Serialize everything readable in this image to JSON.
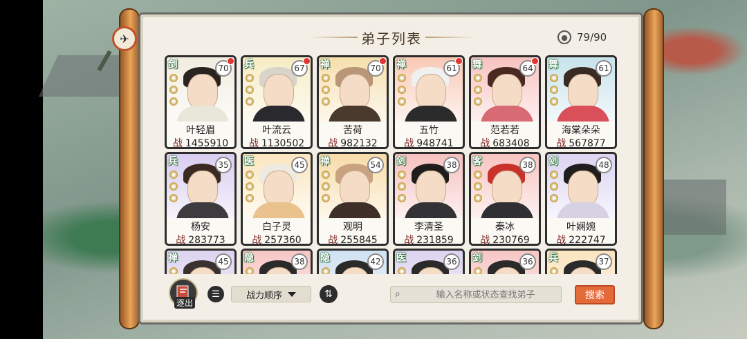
{
  "title": "弟子列表",
  "capacity": "79/90",
  "colors": {
    "accent": "#e56a3a",
    "panel": "#f3efe6",
    "frame": "#2d2d2d"
  },
  "cards": [
    {
      "name": "叶轻眉",
      "power": "1455910",
      "level": "70",
      "sect": "剑",
      "bg": "#f1ede0",
      "hair": "#2a2420",
      "robe": "#e9e6da",
      "badge": true
    },
    {
      "name": "叶流云",
      "power": "1130502",
      "level": "67",
      "sect": "兵",
      "bg": "#f6ecc4",
      "hair": "#d8d4ca",
      "robe": "#2a2a2e",
      "badge": true
    },
    {
      "name": "苦荷",
      "power": "982132",
      "level": "70",
      "sect": "禅",
      "bg": "#f6dfad",
      "hair": "#b89677",
      "robe": "#4a3a2e",
      "badge": true
    },
    {
      "name": "五竹",
      "power": "948741",
      "level": "61",
      "sect": "禅",
      "bg": "#f9c9b5",
      "hair": "#f0f0f0",
      "robe": "#2b2b2b",
      "badge": true
    },
    {
      "name": "范若若",
      "power": "683408",
      "level": "64",
      "sect": "舞",
      "bg": "#f7c2bf",
      "hair": "#4a2a20",
      "robe": "#d86a73",
      "badge": true
    },
    {
      "name": "海棠朵朵",
      "power": "567877",
      "level": "61",
      "sect": "舞",
      "bg": "#c8e3ec",
      "hair": "#3a2a24",
      "robe": "#d94f5a",
      "badge": false
    },
    {
      "name": "杨安",
      "power": "283773",
      "level": "35",
      "sect": "兵",
      "bg": "#d9cdf0",
      "hair": "#3a2a22",
      "robe": "#3d3b3e",
      "badge": false
    },
    {
      "name": "白子灵",
      "power": "257360",
      "level": "45",
      "sect": "医",
      "bg": "#fbe6bf",
      "hair": "#eeeae2",
      "robe": "#e9c28d",
      "badge": false
    },
    {
      "name": "观明",
      "power": "255845",
      "level": "54",
      "sect": "禅",
      "bg": "#f8dca9",
      "hair": "#c9a380",
      "robe": "#3e3028",
      "badge": false
    },
    {
      "name": "李清圣",
      "power": "231859",
      "level": "38",
      "sect": "剑",
      "bg": "#f6c1bf",
      "hair": "#1f1d1c",
      "robe": "#333235",
      "badge": false
    },
    {
      "name": "秦冰",
      "power": "230769",
      "level": "38",
      "sect": "客",
      "bg": "#f7c4c1",
      "hair": "#c8322a",
      "robe": "#2f2f34",
      "badge": false
    },
    {
      "name": "叶娴婉",
      "power": "222747",
      "level": "48",
      "sect": "剑",
      "bg": "#dcd4f1",
      "hair": "#1f1d1e",
      "robe": "#d6d2e3",
      "badge": false
    },
    {
      "name": "",
      "power": "",
      "level": "45",
      "sect": "禅",
      "bg": "#dcd3f0",
      "hair": "#3a3230",
      "robe": "#444",
      "badge": false
    },
    {
      "name": "",
      "power": "",
      "level": "38",
      "sect": "隐",
      "bg": "#f6c6c4",
      "hair": "#2a2a2a",
      "robe": "#444",
      "badge": false
    },
    {
      "name": "",
      "power": "",
      "level": "42",
      "sect": "隐",
      "bg": "#cfe1f2",
      "hair": "#2a2a2a",
      "robe": "#444",
      "badge": false
    },
    {
      "name": "",
      "power": "",
      "level": "36",
      "sect": "医",
      "bg": "#dcd3f0",
      "hair": "#2a2a2a",
      "robe": "#444",
      "badge": false
    },
    {
      "name": "",
      "power": "",
      "level": "36",
      "sect": "剑",
      "bg": "#f6c6c4",
      "hair": "#2a2a2a",
      "robe": "#444",
      "badge": false
    },
    {
      "name": "",
      "power": "",
      "level": "37",
      "sect": "兵",
      "bg": "#fbe3bf",
      "hair": "#2a2a2a",
      "robe": "#444",
      "badge": false
    }
  ],
  "power_prefix": "战",
  "toolbar": {
    "expel_label": "逐出",
    "sort_label": "战力顺序",
    "search_placeholder": "输入名称或状态查找弟子",
    "search_button": "搜索"
  },
  "icons": {
    "capacity": "person-circle-icon",
    "expel": "expel-icon",
    "list": "list-icon",
    "swap": "swap-order-icon",
    "search": "magnifier-icon",
    "emblem": "bird-emblem-icon"
  }
}
